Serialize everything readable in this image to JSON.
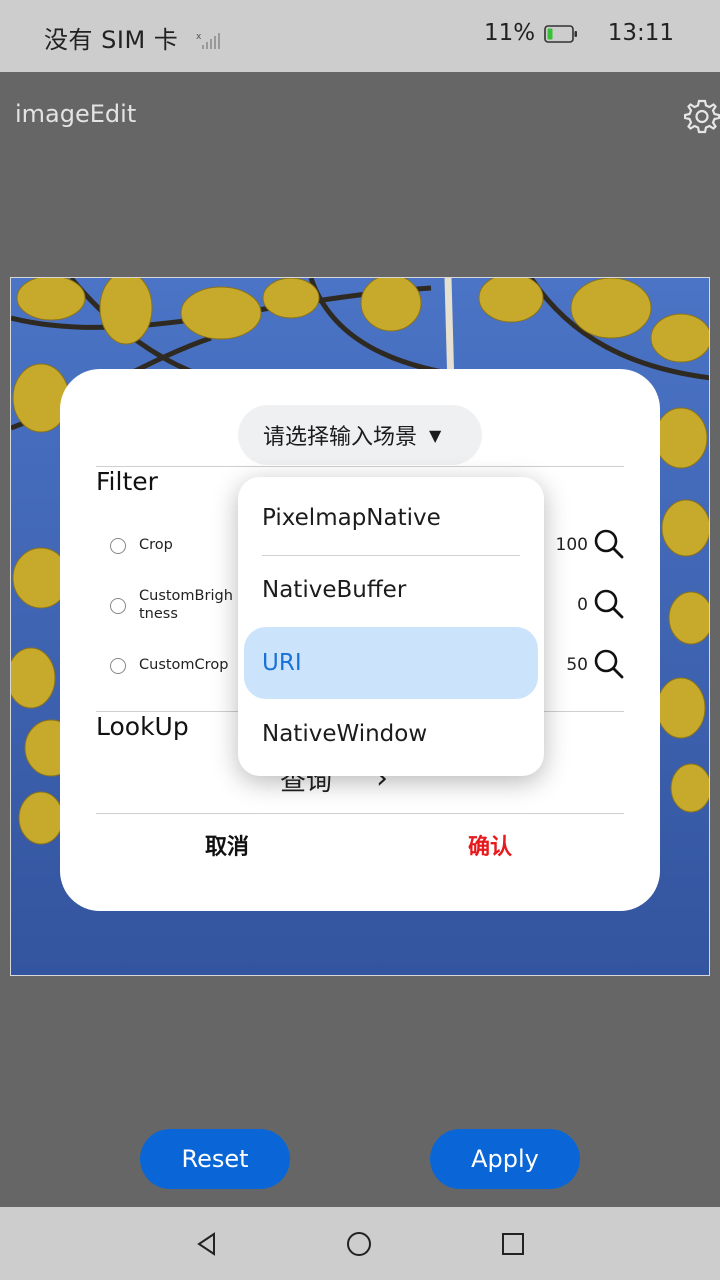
{
  "status_bar": {
    "carrier": "没有 SIM 卡",
    "battery": "11%",
    "time": "13:11"
  },
  "app_bar": {
    "title": "imageEdit",
    "settings_icon": "gear-icon"
  },
  "dialog": {
    "scene_select": {
      "placeholder": "请选择输入场景",
      "options": [
        "PixelmapNative",
        "NativeBuffer",
        "URI",
        "NativeWindow"
      ],
      "highlighted": "URI"
    },
    "filter": {
      "title": "Filter",
      "items": [
        {
          "label": "Crop",
          "value": "100"
        },
        {
          "label": "CustomBrightness",
          "value": "0"
        },
        {
          "label": "CustomCrop",
          "value": "50"
        }
      ]
    },
    "lookup": {
      "title": "LookUp",
      "query_label": "查询"
    },
    "cancel_label": "取消",
    "confirm_label": "确认"
  },
  "actions": {
    "reset_label": "Reset",
    "apply_label": "Apply"
  },
  "colors": {
    "accent": "#0a66d6",
    "confirm": "#e8191c",
    "menu_highlight": "#cce4fb"
  }
}
